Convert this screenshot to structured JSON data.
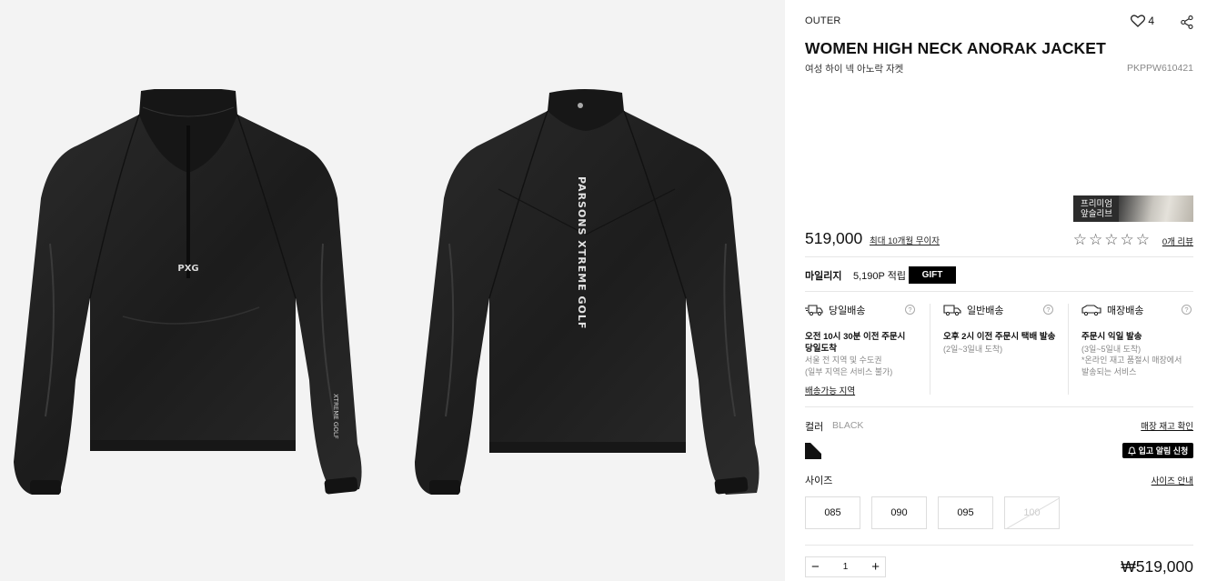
{
  "product": {
    "category": "OUTER",
    "name": "WOMEN HIGH NECK ANORAK JACKET",
    "name_ko": "여성 하이 넥 아노락 자켓",
    "sku": "PKPPW610421",
    "likes": "4",
    "price": "519,000",
    "installment": "최대 10개월 무이자",
    "rating_stars": "☆☆☆☆☆",
    "review_link": "0개 리뷰",
    "premium_label": "프리미엄\n앞슬리브"
  },
  "mileage": {
    "label": "마일리지",
    "value": "5,190P 적립",
    "gift": "GIFT"
  },
  "shipping": [
    {
      "title": "당일배송",
      "strong": "오전 10시 30분 이전 주문시\n당일도착",
      "note": "서울 전 지역 및 수도권\n(일부 지역은 서비스 불가)",
      "icon": "truck-fast-icon"
    },
    {
      "title": "일반배송",
      "strong": "오후 2시 이전 주문시 택배 발송",
      "note": "(2일~3일내 도착)",
      "icon": "truck-icon"
    },
    {
      "title": "매장배송",
      "strong": "주문시 익일 발송",
      "note": "(3일~5일내 도착)\n*온라인 재고 품절시 매장에서\n발송되는 서비스",
      "icon": "store-truck-icon"
    }
  ],
  "shipping_area_link": "배송가능 지역",
  "help_glyph": "?",
  "color": {
    "label": "컬러",
    "value": "BLACK",
    "stock_link": "매장 재고 확인",
    "alert_button": "입고 알림 신청",
    "swatch_hex": "#111111"
  },
  "size": {
    "label": "사이즈",
    "guide_link": "사이즈 안내",
    "options": [
      {
        "label": "085",
        "soldout": false
      },
      {
        "label": "090",
        "soldout": false
      },
      {
        "label": "095",
        "soldout": false
      },
      {
        "label": "100",
        "soldout": true
      }
    ]
  },
  "quantity": {
    "minus": "−",
    "value": "1",
    "plus": "+"
  },
  "total": "₩519,000",
  "front_print": {
    "logo": "PXG",
    "sleeve": "XTREME GOLF",
    "zip": "PARSONS XTREME GOLF"
  },
  "back_print": "PARSONS XTREME GOLF"
}
